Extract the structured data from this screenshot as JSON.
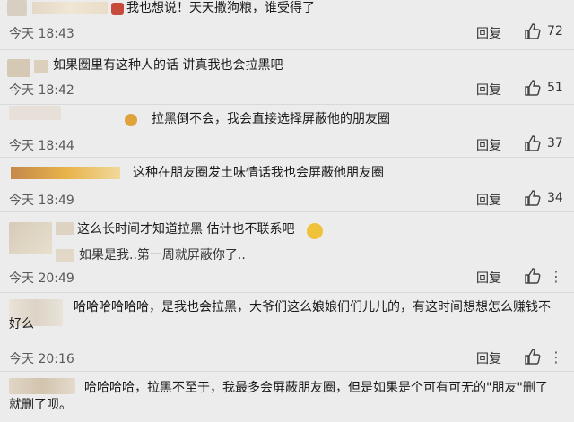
{
  "comments": [
    {
      "text": "我也想说！天天撒狗粮，谁受得了",
      "time": "今天 18:43",
      "reply": "回复",
      "likes": "72"
    },
    {
      "text": "如果圈里有这种人的话 讲真我也会拉黑吧",
      "time": "今天 18:42",
      "reply": "回复",
      "likes": "51"
    },
    {
      "text": "拉黑倒不会，我会直接选择屏蔽他的朋友圈",
      "time": "今天 18:44",
      "reply": "回复",
      "likes": "37"
    },
    {
      "text": "这种在朋友圈发土味情话我也会屏蔽他朋友圈",
      "time": "今天 18:49",
      "reply": "回复",
      "likes": "34"
    },
    {
      "text": "这么长时间才知道拉黑 估计也不联系吧",
      "subtext": "如果是我..第一周就屏蔽你了..",
      "time": "今天 20:49",
      "reply": "回复",
      "likes": ""
    },
    {
      "text": "哈哈哈哈哈哈，是我也会拉黑，大爷们这么娘娘们们儿儿的，有这时间想想怎么赚钱不好么",
      "time": "今天 20:16",
      "reply": "回复",
      "likes": ""
    },
    {
      "text": "哈哈哈哈，拉黑不至于，我最多会屏蔽朋友圈，但是如果是个可有可无的\"朋友\"删了就删了呗。",
      "time": "",
      "reply": "",
      "likes": ""
    }
  ],
  "icons": {
    "like": "thumbs-up-icon",
    "more": "more-icon",
    "emoji": "emoji-icon"
  },
  "colors": {
    "bg": "#ececec",
    "divider": "#d9d9d9",
    "text": "#1a1a1a",
    "meta": "#5a5a5a"
  }
}
